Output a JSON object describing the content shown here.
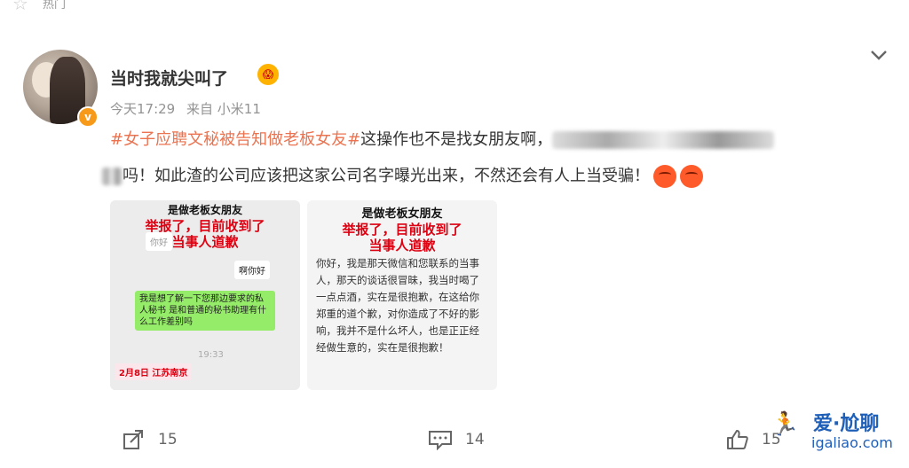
{
  "top": {
    "label": "热门"
  },
  "post": {
    "username": "当时我就尖叫了",
    "time": "今天17:29",
    "source": "来自 小米11",
    "hashtag": "#女子应聘文秘被告知做老板女友#",
    "text_part1": "这操作也不是找女朋友啊，",
    "text_part2": "吗！如此渣的公司应该把这家公司名字曝光出来，不然还会有人上当受骗！"
  },
  "images": {
    "img1": {
      "caption_top": "是做老板女朋友",
      "caption_red": "举报了，目前收到了",
      "caption_red2": "当事人道歉",
      "bubble_hello_grey": "你好",
      "bubble_hello": "啊你好",
      "bubble_green": "我是想了解一下您那边要求的私人秘书 是和普通的秘书助理有什么工作差别吗",
      "time": "19:33",
      "date_tag": "2月8日 江苏南京"
    },
    "img2": {
      "caption_top": "是做老板女朋友",
      "caption_red": "举报了，目前收到了",
      "caption_red2": "当事人道歉",
      "letter": "你好，我是那天微信和您联系的当事人，那天的谈话很冒昧，我当时喝了一点点酒，实在是很抱歉，在这给你郑重的道个歉，对你造成了不好的影响，我并不是什么坏人，也是正正经经做生意的，实在是很抱歉！"
    }
  },
  "actions": {
    "repost_count": "15",
    "comment_count": "14",
    "like_count": "15"
  },
  "watermark": {
    "title": "爱·尬聊",
    "url": "igaliao.com"
  },
  "colors": {
    "hashtag": "#eb7350",
    "badge": "#f79a1a",
    "meta": "#939393"
  }
}
